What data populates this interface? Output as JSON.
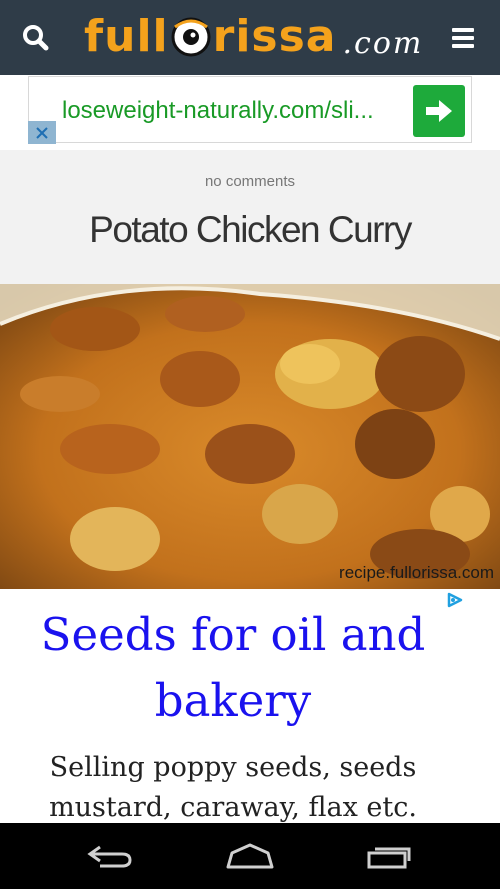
{
  "header": {
    "logo_full": "full",
    "logo_rissa": "rissa",
    "logo_dotcom": ".com",
    "icons": {
      "search": "search-icon",
      "menu": "hamburger-menu-icon"
    },
    "colors": {
      "background": "#2f3c48",
      "logo": "#f4a21c"
    }
  },
  "ad_banner": {
    "url_text": "loseweight-naturally.com/sli...",
    "icons": {
      "go": "arrow-right-icon",
      "close": "close-icon"
    },
    "colors": {
      "url": "#199a26",
      "button": "#1eaa3b"
    }
  },
  "post": {
    "comments": "no comments",
    "title": "Potato Chicken Curry",
    "image_watermark": "recipe.fullorissa.com"
  },
  "ad2": {
    "title": "Seeds for oil and bakery",
    "body": "Selling poppy seeds, seeds mustard, caraway, flax etc.",
    "icons": {
      "adchoices": "adchoices-icon"
    },
    "colors": {
      "title": "#1a12ee"
    }
  },
  "navbar": {
    "icons": {
      "back": "back-icon",
      "home": "home-icon",
      "recents": "recent-apps-icon"
    }
  }
}
